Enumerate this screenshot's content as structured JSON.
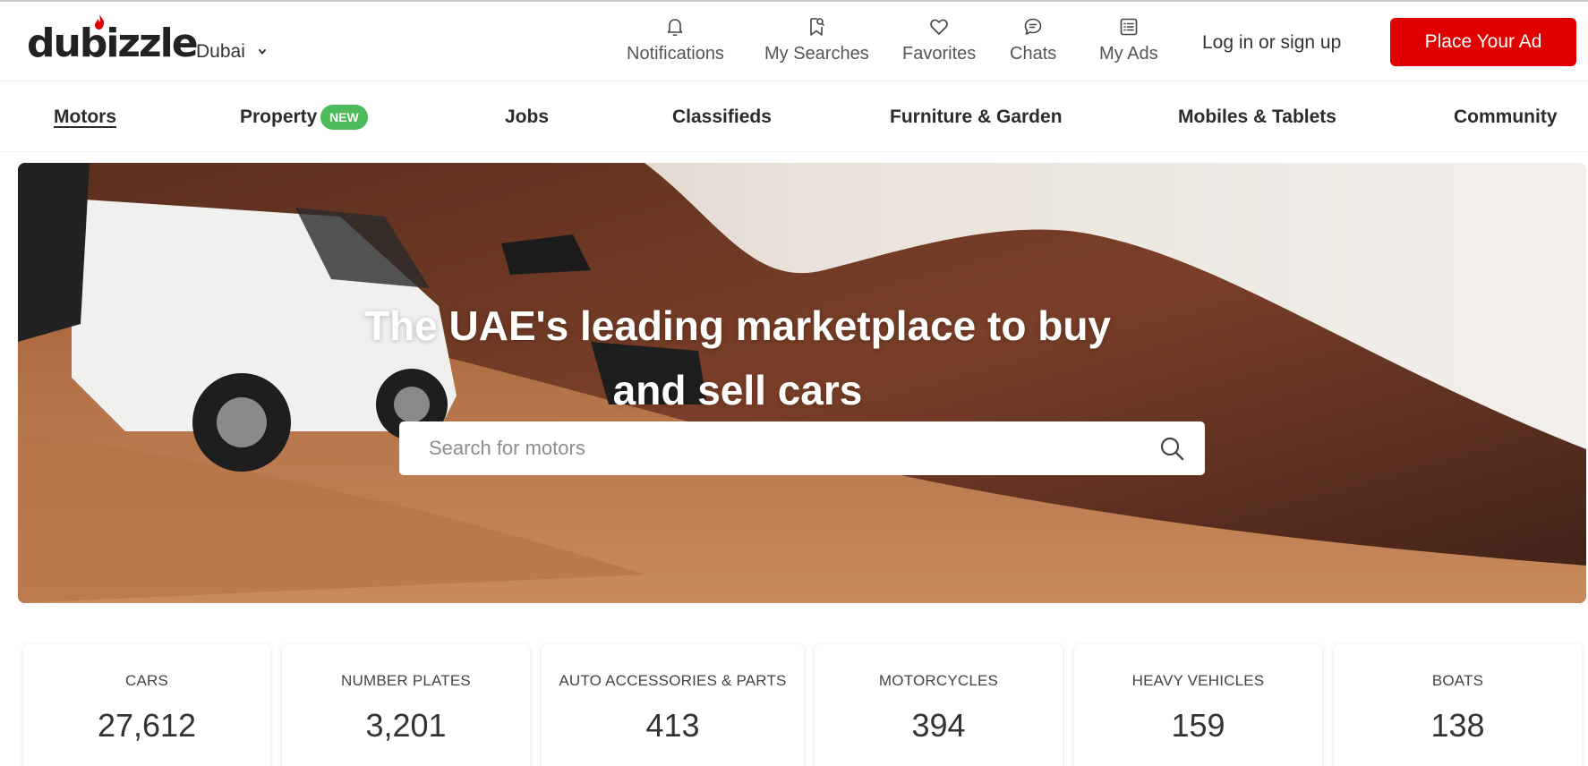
{
  "header": {
    "logo_text": "dubizzle",
    "city": "Dubai",
    "nav": [
      {
        "label": "Notifications",
        "icon": "bell-icon"
      },
      {
        "label": "My Searches",
        "icon": "bookmark-search-icon"
      },
      {
        "label": "Favorites",
        "icon": "heart-icon"
      },
      {
        "label": "Chats",
        "icon": "chat-icon"
      },
      {
        "label": "My Ads",
        "icon": "list-icon"
      }
    ],
    "login": "Log in or sign up",
    "place_ad": "Place Your Ad",
    "accent_color": "#e00000"
  },
  "categories": [
    {
      "label": "Motors",
      "active": true
    },
    {
      "label": "Property",
      "badge": "NEW"
    },
    {
      "label": "Jobs"
    },
    {
      "label": "Classifieds"
    },
    {
      "label": "Furniture & Garden"
    },
    {
      "label": "Mobiles & Tablets"
    },
    {
      "label": "Community"
    }
  ],
  "hero": {
    "headline_line1": "The UAE's leading marketplace to buy",
    "headline_line2": "and sell cars",
    "search_placeholder": "Search for motors"
  },
  "stats": [
    {
      "title": "CARS",
      "count": "27,612"
    },
    {
      "title": "NUMBER PLATES",
      "count": "3,201"
    },
    {
      "title": "AUTO ACCESSORIES & PARTS",
      "count": "413"
    },
    {
      "title": "MOTORCYCLES",
      "count": "394"
    },
    {
      "title": "HEAVY VEHICLES",
      "count": "159"
    },
    {
      "title": "BOATS",
      "count": "138"
    }
  ]
}
